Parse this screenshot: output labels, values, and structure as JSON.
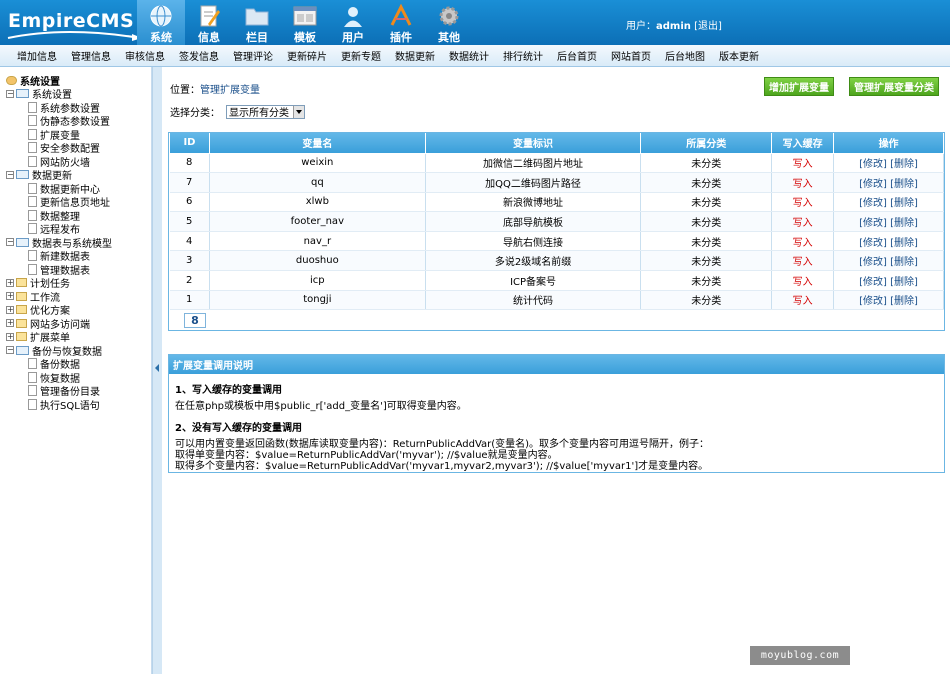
{
  "header": {
    "logo": "EmpireCMS",
    "nav": [
      {
        "label": "系统",
        "icon": "globe-icon",
        "active": true
      },
      {
        "label": "信息",
        "icon": "document-icon"
      },
      {
        "label": "栏目",
        "icon": "folder-icon"
      },
      {
        "label": "模板",
        "icon": "template-icon"
      },
      {
        "label": "用户",
        "icon": "user-icon"
      },
      {
        "label": "插件",
        "icon": "tools-icon"
      },
      {
        "label": "其他",
        "icon": "gear-icon"
      }
    ],
    "user_prefix": "用户：",
    "username": "admin",
    "logout": "[退出]"
  },
  "subnav": [
    "增加信息",
    "管理信息",
    "审核信息",
    "签发信息",
    "管理评论",
    "更新碎片",
    "更新专题",
    "数据更新",
    "数据统计",
    "排行统计",
    "后台首页",
    "网站首页",
    "后台地图",
    "版本更新"
  ],
  "sidebar": {
    "root": "系统设置",
    "groups": [
      {
        "label": "系统设置",
        "open": true,
        "items": [
          "系统参数设置",
          "伪静态参数设置",
          "扩展变量",
          "安全参数配置",
          "网站防火墙"
        ]
      },
      {
        "label": "数据更新",
        "open": true,
        "items": [
          "数据更新中心",
          "更新信息页地址",
          "数据整理",
          "远程发布"
        ]
      },
      {
        "label": "数据表与系统模型",
        "open": true,
        "items": [
          "新建数据表",
          "管理数据表"
        ]
      },
      {
        "label": "计划任务",
        "open": false,
        "items": []
      },
      {
        "label": "工作流",
        "open": false,
        "items": []
      },
      {
        "label": "优化方案",
        "open": false,
        "items": []
      },
      {
        "label": "网站多访问端",
        "open": false,
        "items": []
      },
      {
        "label": "扩展菜单",
        "open": false,
        "items": []
      },
      {
        "label": "备份与恢复数据",
        "open": true,
        "items": [
          "备份数据",
          "恢复数据",
          "管理备份目录",
          "执行SQL语句"
        ]
      }
    ]
  },
  "main": {
    "position_prefix": "位置：",
    "position_link": "管理扩展变量",
    "btn_add": "增加扩展变量",
    "btn_manage_cat": "管理扩展变量分类",
    "category_label": "选择分类：",
    "category_value": "显示所有分类",
    "table": {
      "headers": [
        "ID",
        "变量名",
        "变量标识",
        "所属分类",
        "写入缓存",
        "操作"
      ],
      "rows": [
        [
          "8",
          "weixin",
          "加微信二维码图片地址",
          "未分类",
          "写入",
          "[修改] [删除]"
        ],
        [
          "7",
          "qq",
          "加QQ二维码图片路径",
          "未分类",
          "写入",
          "[修改] [删除]"
        ],
        [
          "6",
          "xlwb",
          "新浪微博地址",
          "未分类",
          "写入",
          "[修改] [删除]"
        ],
        [
          "5",
          "footer_nav",
          "底部导航模板",
          "未分类",
          "写入",
          "[修改] [删除]"
        ],
        [
          "4",
          "nav_r",
          "导航右侧连接",
          "未分类",
          "写入",
          "[修改] [删除]"
        ],
        [
          "3",
          "duoshuo",
          "多说2级域名前缀",
          "未分类",
          "写入",
          "[修改] [删除]"
        ],
        [
          "2",
          "icp",
          "ICP备案号",
          "未分类",
          "写入",
          "[修改] [删除]"
        ],
        [
          "1",
          "tongji",
          "统计代码",
          "未分类",
          "写入",
          "[修改] [删除]"
        ]
      ],
      "page": "8"
    },
    "help": {
      "title": "扩展变量调用说明",
      "h1": "1、写入缓存的变量调用",
      "p1": "在任意php或模板中用$public_r['add_变量名']可取得变量内容。",
      "h2": "2、没有写入缓存的变量调用",
      "p2": "可以用内置变量返回函数(数据库读取变量内容)：ReturnPublicAddVar(变量名)。取多个变量内容可用逗号隔开，例子：",
      "p3": "取得单变量内容：$value=ReturnPublicAddVar('myvar'); //$value就是变量内容。",
      "p4": "取得多个变量内容：$value=ReturnPublicAddVar('myvar1,myvar2,myvar3'); //$value['myvar1']才是变量内容。"
    }
  },
  "watermark": "moyublog.com"
}
